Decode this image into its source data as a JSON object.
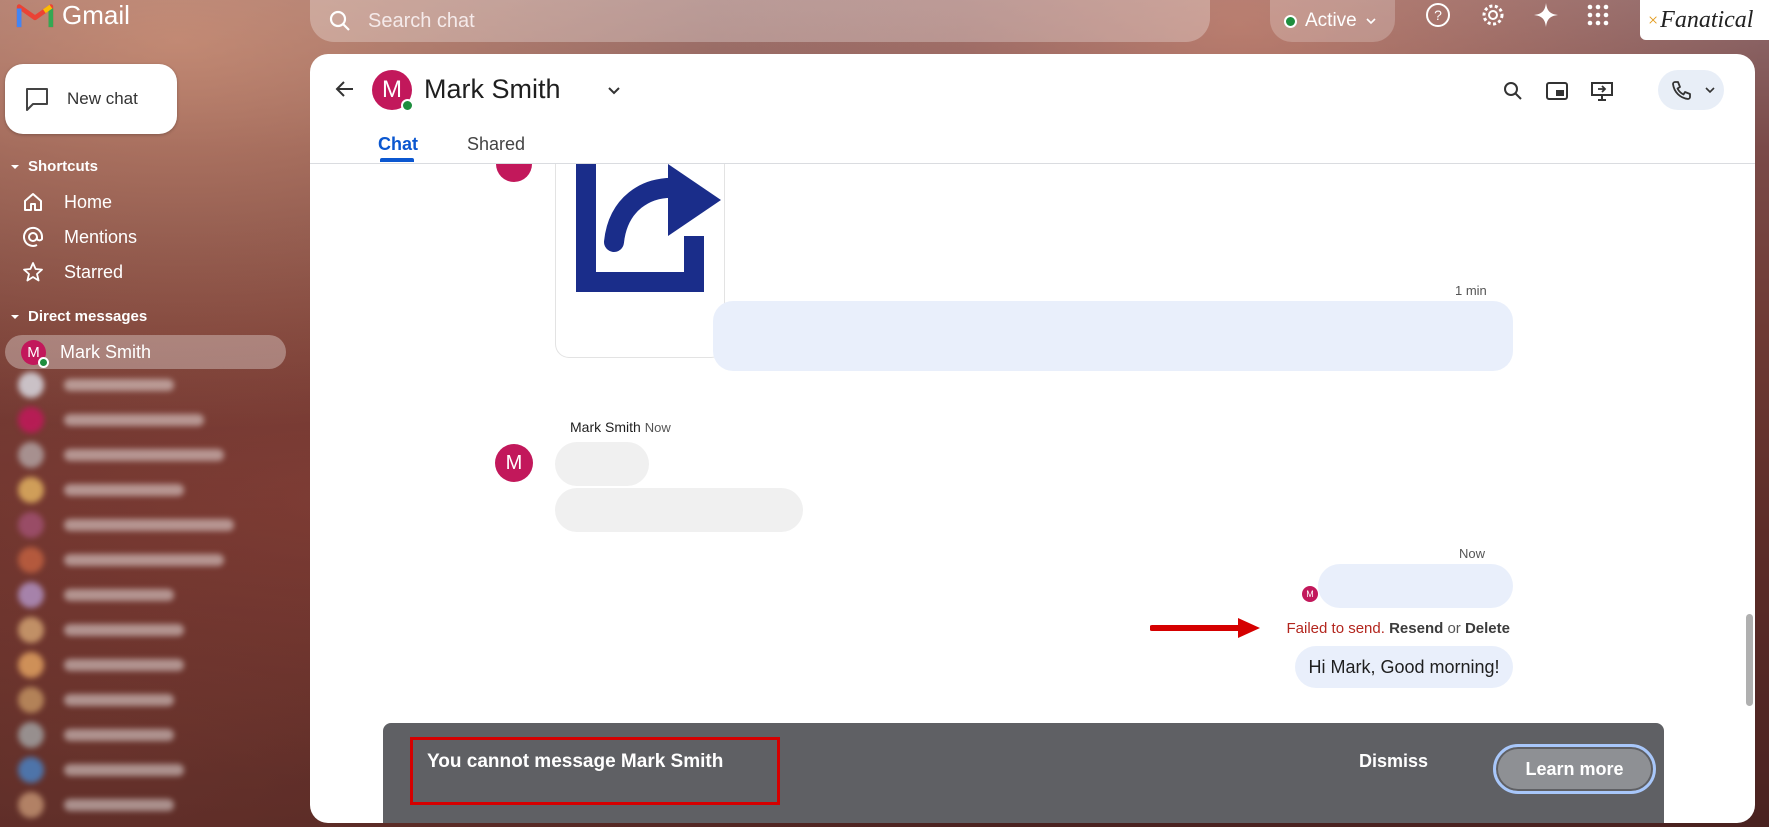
{
  "app": {
    "name": "Gmail"
  },
  "search": {
    "placeholder": "Search chat"
  },
  "status": {
    "label": "Active",
    "color": "#1e8e3e"
  },
  "brand_chip": {
    "text": "Fanatical",
    "prefix": "×"
  },
  "sidebar": {
    "new_chat_label": "New chat",
    "shortcuts_heading": "Shortcuts",
    "shortcuts": [
      {
        "label": "Home",
        "icon": "home-icon"
      },
      {
        "label": "Mentions",
        "icon": "at-icon"
      },
      {
        "label": "Starred",
        "icon": "star-icon"
      }
    ],
    "dm_heading": "Direct messages",
    "active_dm": {
      "name": "Mark Smith",
      "initial": "M"
    },
    "blurred_dm_count": 13
  },
  "chat": {
    "contact_name": "Mark Smith",
    "contact_initial": "M",
    "tabs": [
      {
        "label": "Chat",
        "active": true
      },
      {
        "label": "Shared",
        "active": false
      }
    ],
    "messages": {
      "outgoing_time_1": "1 min",
      "incoming_sender": "Mark Smith",
      "incoming_time": "Now",
      "outgoing_time_2": "Now",
      "read_avatar_initial": "M",
      "failed_text": "Failed to send.",
      "resend_label": "Resend",
      "or_text": "or",
      "delete_label": "Delete",
      "final_message": "Hi Mark, Good morning!"
    }
  },
  "banner": {
    "text": "You cannot message Mark Smith",
    "dismiss_label": "Dismiss",
    "learn_more_label": "Learn more"
  },
  "colors": {
    "accent": "#0b57d0",
    "avatar": "#c2185b",
    "error": "#b3261e",
    "annotation": "#d50000",
    "banner_bg": "#5f6064",
    "outgoing_bubble": "#e9effb"
  }
}
